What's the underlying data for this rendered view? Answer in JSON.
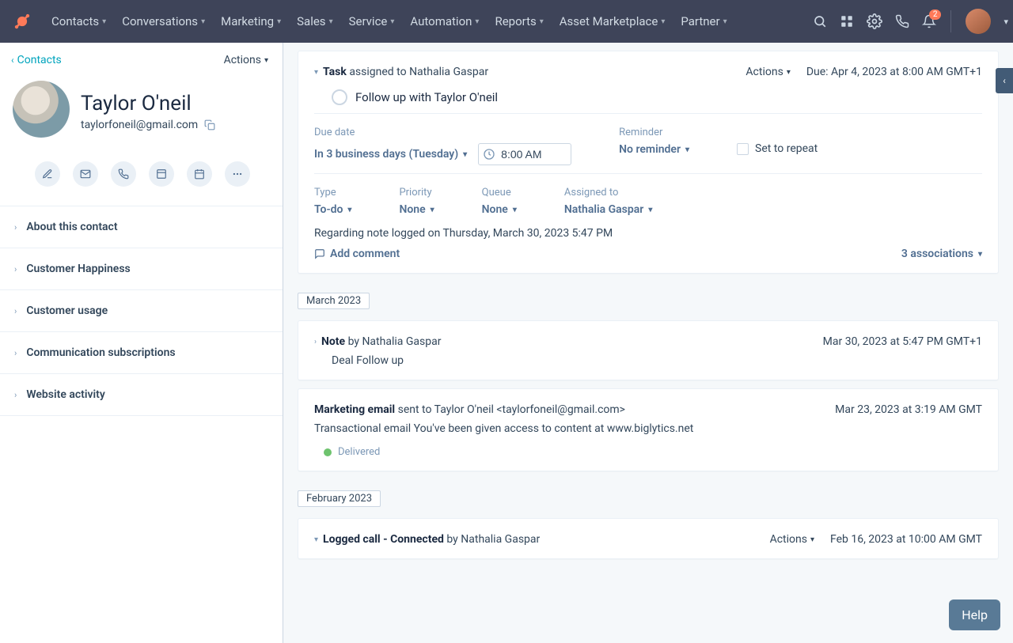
{
  "nav": {
    "links": [
      "Contacts",
      "Conversations",
      "Marketing",
      "Sales",
      "Service",
      "Automation",
      "Reports",
      "Asset Marketplace",
      "Partner"
    ],
    "notif_count": "2"
  },
  "left": {
    "back_label": "Contacts",
    "actions_label": "Actions",
    "name": "Taylor O'neil",
    "email": "taylorfoneil@gmail.com",
    "accordion": [
      "About this contact",
      "Customer Happiness",
      "Customer usage",
      "Communication subscriptions",
      "Website activity"
    ]
  },
  "timeline": {
    "task": {
      "header_prefix": "Task",
      "header_rest": " assigned to Nathalia Gaspar",
      "actions_label": "Actions",
      "due_prefix": "Due: ",
      "due_value": "Apr 4, 2023 at 8:00 AM GMT+1",
      "title": "Follow up with Taylor O'neil",
      "due_date_label": "Due date",
      "due_date_value": "In 3 business days (Tuesday)",
      "time_value": "8:00 AM",
      "reminder_label": "Reminder",
      "reminder_value": "No reminder",
      "repeat_label": "Set to repeat",
      "type_label": "Type",
      "type_value": "To-do",
      "priority_label": "Priority",
      "priority_value": "None",
      "queue_label": "Queue",
      "queue_value": "None",
      "assigned_label": "Assigned to",
      "assigned_value": "Nathalia Gaspar",
      "regarding": "Regarding note logged on Thursday, March 30, 2023 5:47 PM",
      "add_comment": "Add comment",
      "associations": "3 associations"
    },
    "march": {
      "chip": "March 2023",
      "note_prefix": "Note",
      "note_rest": " by Nathalia Gaspar",
      "note_date": "Mar 30, 2023 at 5:47 PM GMT+1",
      "note_body": "Deal Follow up",
      "email_prefix": "Marketing email",
      "email_rest": " sent to Taylor O'neil <taylorfoneil@gmail.com>",
      "email_date": "Mar 23, 2023 at 3:19 AM GMT",
      "email_body": "Transactional email You've been given access to content at www.biglytics.net",
      "delivered": "Delivered"
    },
    "feb": {
      "chip": "February 2023",
      "call_prefix": "Logged call",
      "call_status": " - Connected",
      "call_rest": " by Nathalia Gaspar",
      "actions_label": "Actions",
      "call_date": "Feb 16, 2023 at 10:00 AM GMT"
    }
  },
  "help_label": "Help"
}
